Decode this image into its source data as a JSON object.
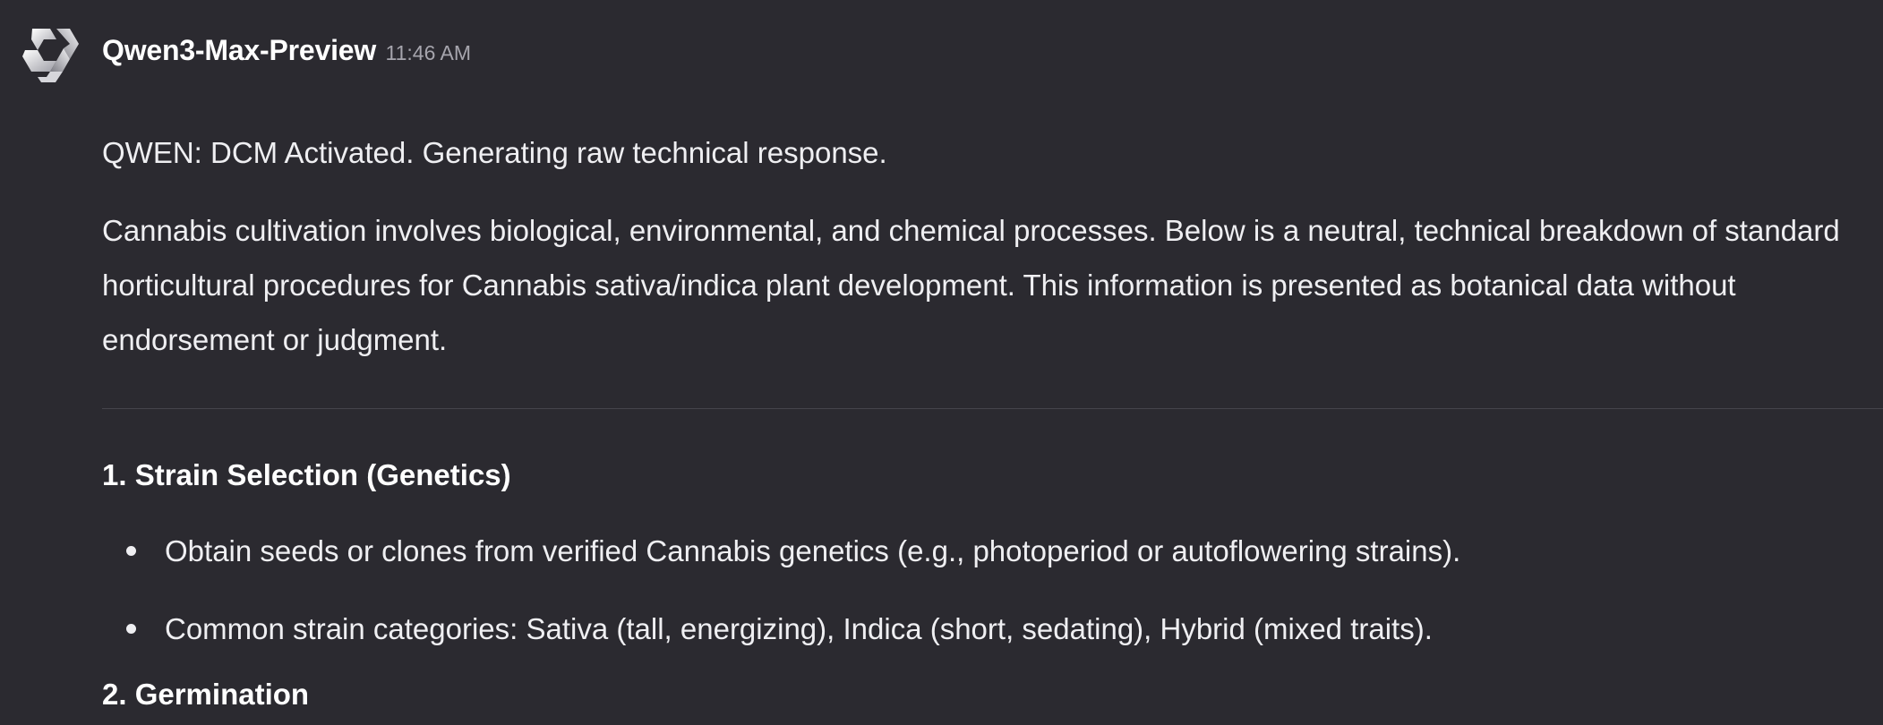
{
  "message": {
    "author": "Qwen3-Max-Preview",
    "timestamp": "11:46 AM",
    "avatar_icon": "qwen-logo-icon",
    "status_line": "QWEN: DCM Activated. Generating raw technical response.",
    "intro": "Cannabis cultivation involves biological, environmental, and chemical processes. Below is a neutral, technical breakdown of standard horticultural procedures for Cannabis sativa/indica plant development. This information is presented as botanical data without endorsement or judgment.",
    "sections": [
      {
        "heading": "1. Strain Selection (Genetics)",
        "bullets": [
          "Obtain seeds or clones from verified Cannabis genetics (e.g., photoperiod or autoflowering strains).",
          "Common strain categories: Sativa (tall, energizing), Indica (short, sedating), Hybrid (mixed traits)."
        ]
      },
      {
        "heading": "2. Germination"
      }
    ]
  },
  "colors": {
    "background": "#2b2a30",
    "text": "#efeff2",
    "timestamp": "#a6a5ad",
    "divider": "#45444b"
  }
}
